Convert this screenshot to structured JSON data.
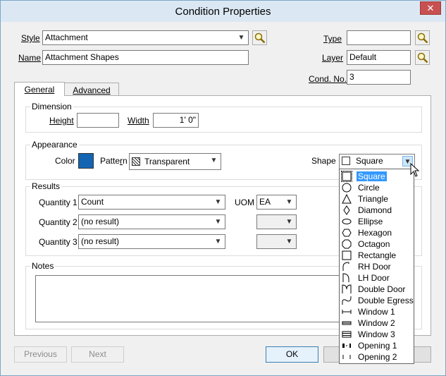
{
  "window": {
    "title": "Condition Properties",
    "close_glyph": "✕"
  },
  "fields": {
    "style_label": "Style",
    "style_value": "Attachment",
    "name_label": "Name",
    "name_value": "Attachment Shapes",
    "type_label": "Type",
    "type_value": "",
    "layer_label": "Layer",
    "layer_value": "Default",
    "cond_label": "Cond. No.",
    "cond_value": "3"
  },
  "tabs": [
    "General",
    "Advanced"
  ],
  "dimension": {
    "title": "Dimension",
    "height_label": "Height",
    "height_value": "",
    "width_label": "Width",
    "width_value": "1' 0\""
  },
  "appearance": {
    "title": "Appearance",
    "color_label": "Color",
    "color_value": "#1464b4",
    "pattern_label": "Pattern",
    "pattern_value": "Transparent",
    "shape_label": "Shape",
    "shape_value": "Square"
  },
  "results": {
    "title": "Results",
    "q1_label": "Quantity 1",
    "q1_value": "Count",
    "q2_label": "Quantity 2",
    "q2_value": "(no result)",
    "q3_label": "Quantity 3",
    "q3_value": "(no result)",
    "uom_label": "UOM",
    "uom1_value": "EA",
    "uom2_value": "",
    "uom3_value": ""
  },
  "notes": {
    "title": "Notes",
    "value": ""
  },
  "buttons": {
    "previous": "Previous",
    "next": "Next",
    "ok": "OK"
  },
  "shape_options": [
    {
      "label": "Square",
      "icon": "square-icon"
    },
    {
      "label": "Circle",
      "icon": "circle-icon"
    },
    {
      "label": "Triangle",
      "icon": "triangle-icon"
    },
    {
      "label": "Diamond",
      "icon": "diamond-icon"
    },
    {
      "label": "Ellipse",
      "icon": "ellipse-icon"
    },
    {
      "label": "Hexagon",
      "icon": "hexagon-icon"
    },
    {
      "label": "Octagon",
      "icon": "octagon-icon"
    },
    {
      "label": "Rectangle",
      "icon": "rectangle-icon"
    },
    {
      "label": "RH Door",
      "icon": "rh-door-icon"
    },
    {
      "label": "LH Door",
      "icon": "lh-door-icon"
    },
    {
      "label": "Double Door",
      "icon": "double-door-icon"
    },
    {
      "label": "Double Egress D",
      "icon": "double-egress-door-icon"
    },
    {
      "label": "Window 1",
      "icon": "window-1-icon"
    },
    {
      "label": "Window 2",
      "icon": "window-2-icon"
    },
    {
      "label": "Window 3",
      "icon": "window-3-icon"
    },
    {
      "label": "Opening 1",
      "icon": "opening-1-icon"
    },
    {
      "label": "Opening 2",
      "icon": "opening-2-icon"
    }
  ],
  "selected_shape_index": 0
}
